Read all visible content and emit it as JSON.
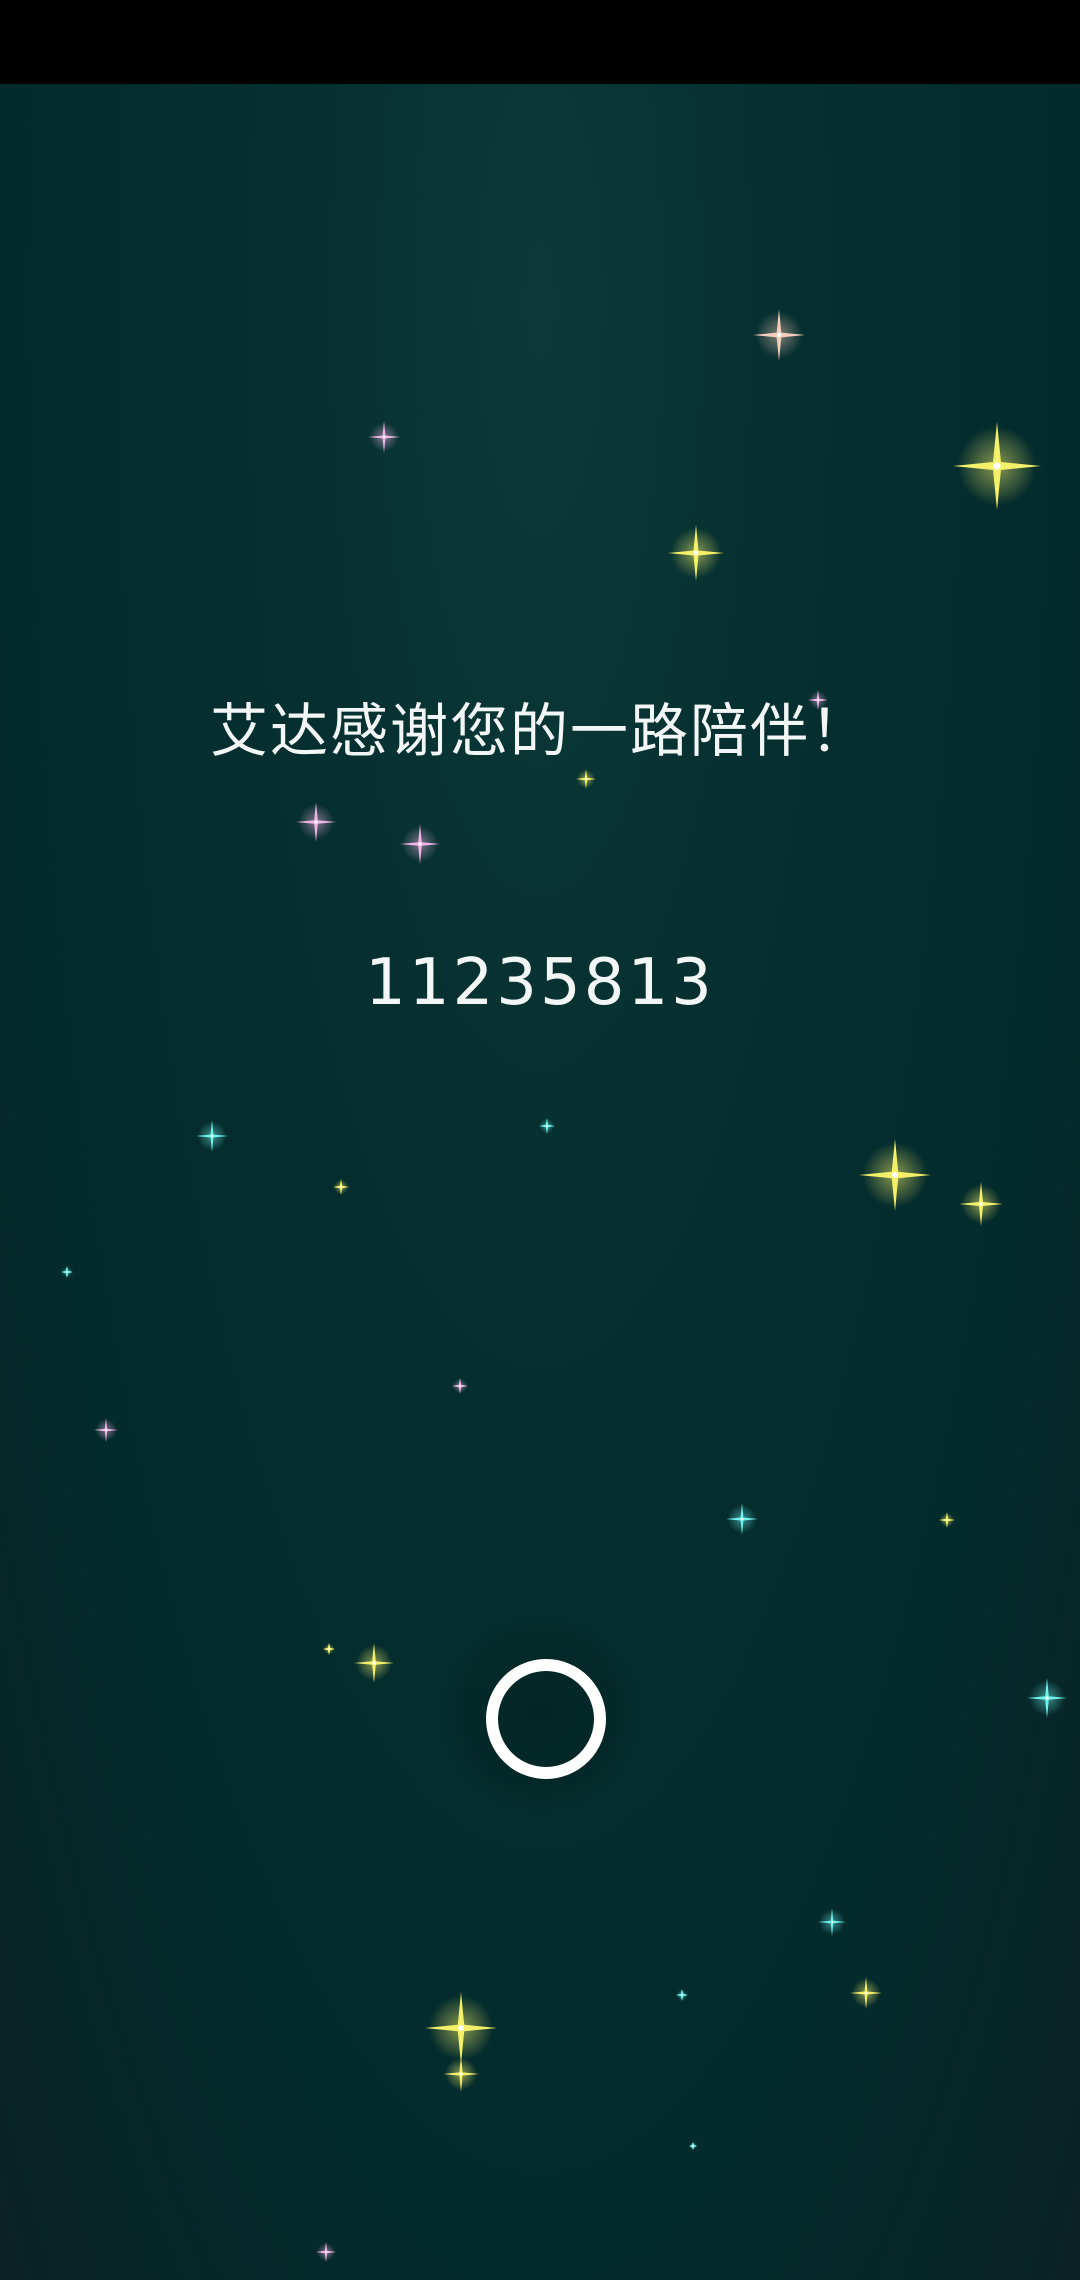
{
  "message": "艾达感谢您的一路陪伴！",
  "code": "11235813",
  "colors": {
    "background": "#042b2c",
    "text": "#f3f6f6",
    "star_yellow": "#f4f06a",
    "star_cyan": "#6ff3ee",
    "star_pink": "#f0b4e6",
    "star_peach": "#f5cdbd"
  },
  "icons": {
    "loading": "ring-spinner-icon",
    "sparkle": "sparkle-star-icon"
  }
}
